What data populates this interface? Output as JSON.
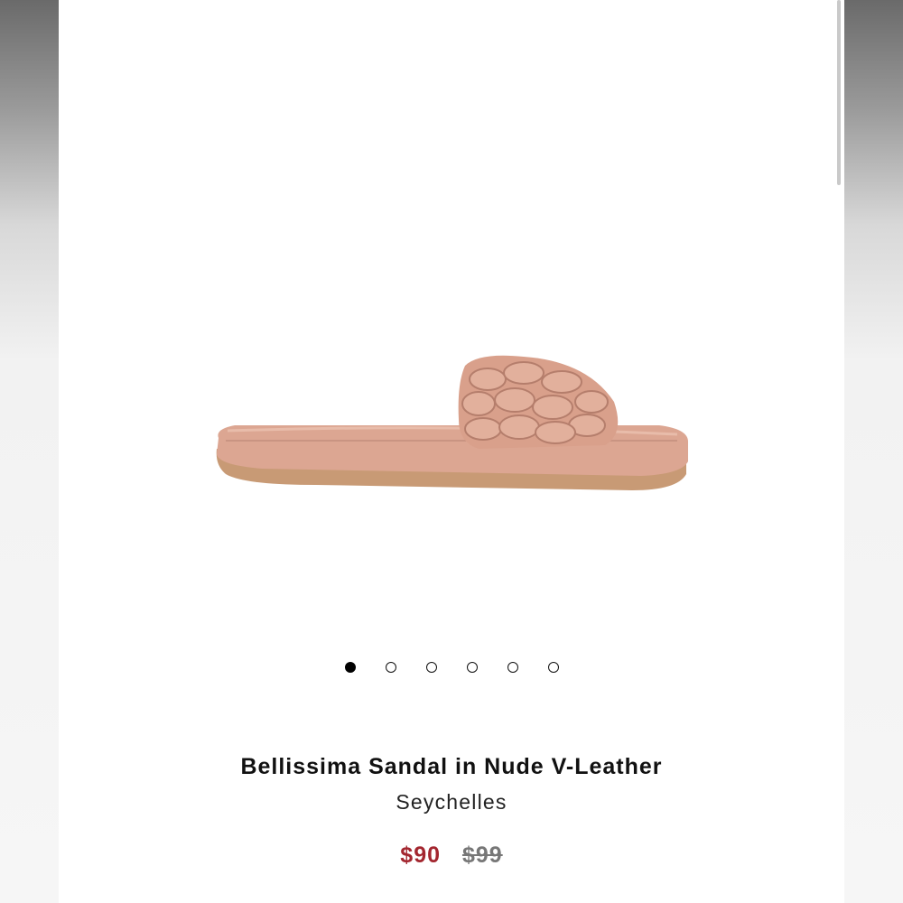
{
  "product": {
    "title": "Bellissima Sandal in Nude V-Leather",
    "brand": "Seychelles",
    "sale_price": "$90",
    "original_price": "$99",
    "image": "braided-slide-sandal-nude"
  },
  "carousel": {
    "total_slides": 6,
    "active_index": 0
  },
  "colors": {
    "sale_price": "#a3262f",
    "original_price": "#777777",
    "sandal": "#dba58f",
    "sole": "#c89a75"
  }
}
